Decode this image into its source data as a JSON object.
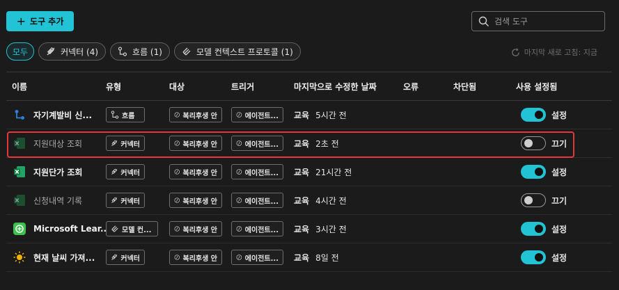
{
  "toolbar": {
    "add_label": "도구 추가"
  },
  "search": {
    "placeholder": "검색 도구"
  },
  "filters": [
    {
      "label": "모두"
    },
    {
      "label": "커넥터 (4)"
    },
    {
      "label": "흐름 (1)"
    },
    {
      "label": "모델 컨텍스트 프로토콜 (1)"
    }
  ],
  "refresh_text": "마지막 새로 고침: 지금",
  "columns": [
    "이름",
    "유형",
    "대상",
    "트리거",
    "마지막으로 수정한 날짜",
    "오류",
    "차단됨",
    "사용 설정됨"
  ],
  "rows": [
    {
      "name": "자기계발비 신...",
      "icon": "flow-icon",
      "type": "흐름",
      "type_icon": "flow-icon",
      "target": "복리후생 안",
      "trigger": "에이전트...",
      "env": "교육",
      "modified": "5시간 전",
      "enabled": "설정"
    },
    {
      "name": "지원대상 조회",
      "icon": "excel-icon",
      "type": "커넥터",
      "type_icon": "connector-icon",
      "target": "복리후생 안",
      "trigger": "에이전트...",
      "env": "교육",
      "modified": "2초 전",
      "enabled": "끄기"
    },
    {
      "name": "지원단가 조회",
      "icon": "excel-icon",
      "type": "커넥터",
      "type_icon": "connector-icon",
      "target": "복리후생 안",
      "trigger": "에이전트...",
      "env": "교육",
      "modified": "21시간 전",
      "enabled": "설정"
    },
    {
      "name": "신청내역 기록",
      "icon": "excel-icon",
      "type": "커넥터",
      "type_icon": "connector-icon",
      "target": "복리후생 안",
      "trigger": "에이전트...",
      "env": "교육",
      "modified": "4시간 전",
      "enabled": "끄기"
    },
    {
      "name": "Microsoft Lear...",
      "icon": "microsoft-learn-icon",
      "type": "모델 컨...",
      "type_icon": "mcp-icon",
      "target": "복리후생 안",
      "trigger": "에이전트...",
      "env": "교육",
      "modified": "3시간 전",
      "enabled": "설정"
    },
    {
      "name": "현재 날씨 가져...",
      "icon": "sun-icon",
      "type": "커넥터",
      "type_icon": "connector-icon",
      "target": "복리후생 안",
      "trigger": "에이전트...",
      "env": "교육",
      "modified": "8일 전",
      "enabled": "설정"
    }
  ],
  "colors": {
    "accent": "#21c3d4",
    "highlight": "#e5383b"
  }
}
